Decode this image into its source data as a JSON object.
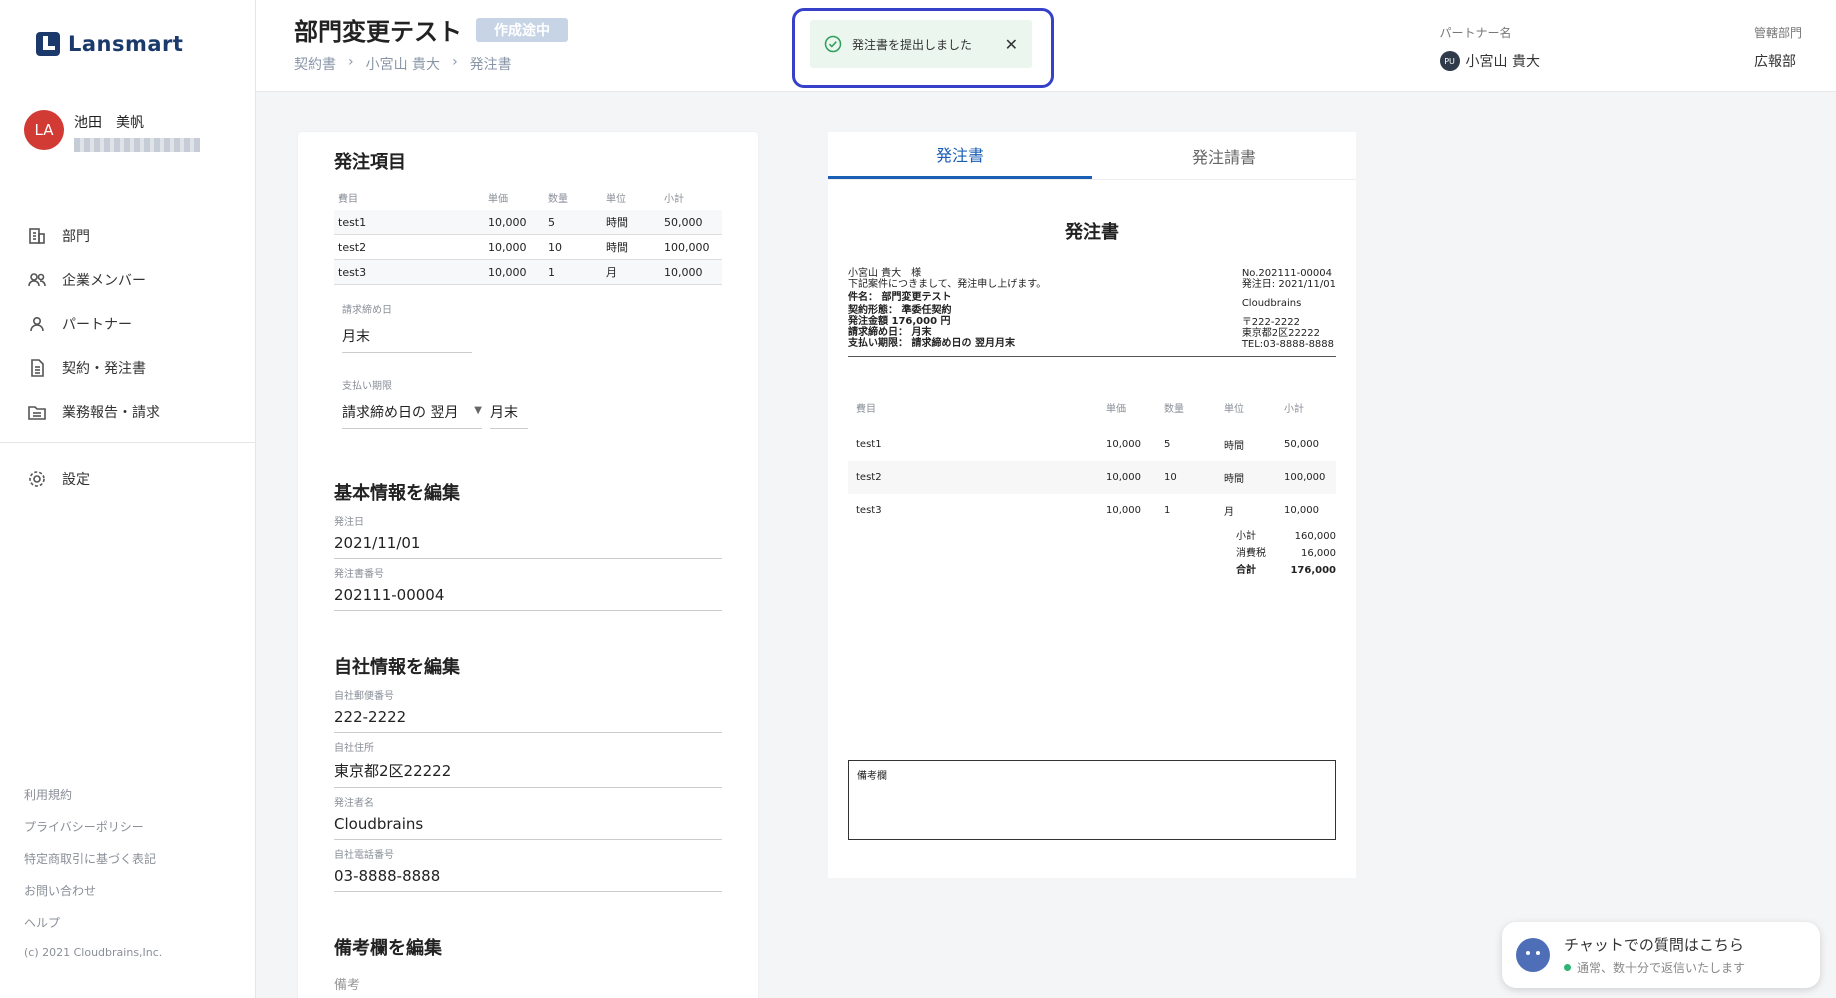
{
  "app": {
    "logo": "Lansmart"
  },
  "user": {
    "initials": "LA",
    "name": "池田　美帆"
  },
  "nav": {
    "items": [
      "部門",
      "企業メンバー",
      "パートナー",
      "契約・発注書",
      "業務報告・請求"
    ],
    "settings": "設定"
  },
  "footer": {
    "links": [
      "利用規約",
      "プライバシーポリシー",
      "特定商取引に基づく表記",
      "お問い合わせ",
      "ヘルプ"
    ],
    "copyright": "(c) 2021 Cloudbrains,Inc."
  },
  "header": {
    "title": "部門変更テスト",
    "status": "作成途中",
    "breadcrumb": [
      "契約書",
      "小宮山 貴大",
      "発注書"
    ],
    "toast": "発注書を提出しました",
    "partner_label": "パートナー名",
    "partner_initials": "PU",
    "partner_name": "小宮山 貴大",
    "dept_label": "管轄部門",
    "dept_name": "広報部"
  },
  "form": {
    "items_title": "発注項目",
    "columns": [
      "費目",
      "単価",
      "数量",
      "単位",
      "小計"
    ],
    "rows": [
      [
        "test1",
        "10,000",
        "5",
        "時間",
        "50,000"
      ],
      [
        "test2",
        "10,000",
        "10",
        "時間",
        "100,000"
      ],
      [
        "test3",
        "10,000",
        "1",
        "月",
        "10,000"
      ]
    ],
    "closing_label": "請求締め日",
    "closing_value": "月末",
    "payment_label": "支払い期限",
    "payment_select": "請求締め日の 翌月",
    "payment_value": "月末",
    "basic_title": "基本情報を編集",
    "order_date_label": "発注日",
    "order_date": "2021/11/01",
    "order_no_label": "発注書番号",
    "order_no": "202111-00004",
    "company_title": "自社情報を編集",
    "zip_label": "自社郵便番号",
    "zip": "222-2222",
    "address_label": "自社住所",
    "address": "東京都2区22222",
    "issuer_label": "発注者名",
    "issuer": "Cloudbrains",
    "phone_label": "自社電話番号",
    "phone": "03-8888-8888",
    "remarks_title": "備考欄を編集",
    "remarks_placeholder": "備考"
  },
  "preview": {
    "tabs": [
      "発注書",
      "発注請書"
    ],
    "doc_title": "発注書",
    "to": "小宮山 貴大　様",
    "intro": "下記案件につきまして、発注申し上げます。",
    "subject": "件名：  部門変更テスト",
    "contract_type": "契約形態：  準委任契約",
    "amount": "発注金額  176,000 円",
    "closing": "請求締め日：  月末",
    "payment": "支払い期限：  請求締め日の 翌月月末",
    "no": "No.202111-00004",
    "date": "発注日: 2021/11/01",
    "company": "Cloudbrains",
    "zip": "〒222-2222",
    "address": "東京都2区22222",
    "tel": "TEL:03-8888-8888",
    "columns": [
      "費目",
      "単価",
      "数量",
      "単位",
      "小計"
    ],
    "rows": [
      [
        "test1",
        "10,000",
        "5",
        "時間",
        "50,000"
      ],
      [
        "test2",
        "10,000",
        "10",
        "時間",
        "100,000"
      ],
      [
        "test3",
        "10,000",
        "1",
        "月",
        "10,000"
      ]
    ],
    "subtotal_label": "小計",
    "subtotal": "160,000",
    "tax_label": "消費税",
    "tax": "16,000",
    "total_label": "合計",
    "total": "176,000",
    "remarks_label": "備考欄"
  },
  "chat": {
    "title": "チャットでの質問はこちら",
    "sub": "通常、数十分で返信いたします"
  }
}
